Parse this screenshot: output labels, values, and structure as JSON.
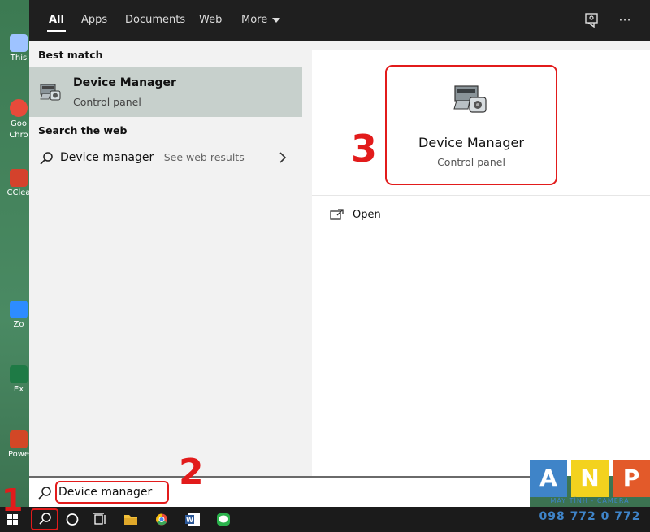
{
  "desktop": {
    "icons": [
      {
        "label": "This",
        "color": "#9ec3ff"
      },
      {
        "label": "Goo\nChro",
        "color": "#e84a3a"
      },
      {
        "label": "CClea",
        "color": "#d4422c"
      },
      {
        "label": "Zo",
        "color": "#2d8cff"
      },
      {
        "label": "Ex",
        "color": "#1e7a45"
      },
      {
        "label": "Powe",
        "color": "#d24726"
      }
    ]
  },
  "tabs": {
    "all": "All",
    "apps": "Apps",
    "documents": "Documents",
    "web": "Web",
    "more": "More"
  },
  "topbar": {
    "feedback_icon": "feedback-icon",
    "more_options": "···"
  },
  "results": {
    "best_match_header": "Best match",
    "best_match": {
      "title": "Device Manager",
      "subtitle": "Control panel"
    },
    "search_web_header": "Search the web",
    "web_result": {
      "query": "Device manager",
      "suffix": " - See web results"
    }
  },
  "preview": {
    "title": "Device Manager",
    "subtitle": "Control panel",
    "actions": [
      {
        "label": "Open"
      }
    ]
  },
  "search": {
    "value": "Device manager"
  },
  "annotations": {
    "step1": "1",
    "step2": "2",
    "step3": "3"
  },
  "logo": {
    "letters": [
      "A",
      "N",
      "P"
    ],
    "colors": [
      "#3f84c8",
      "#f3d21e",
      "#e35a2a"
    ],
    "tagline": "MÁY TÍNH - CAMERA",
    "phone": "098 772 0 772"
  },
  "taskbar": {
    "items": [
      "start-icon",
      "search-icon",
      "cortana-icon",
      "task-view-icon",
      "file-explorer-icon",
      "chrome-icon",
      "word-icon",
      "line-icon"
    ]
  }
}
